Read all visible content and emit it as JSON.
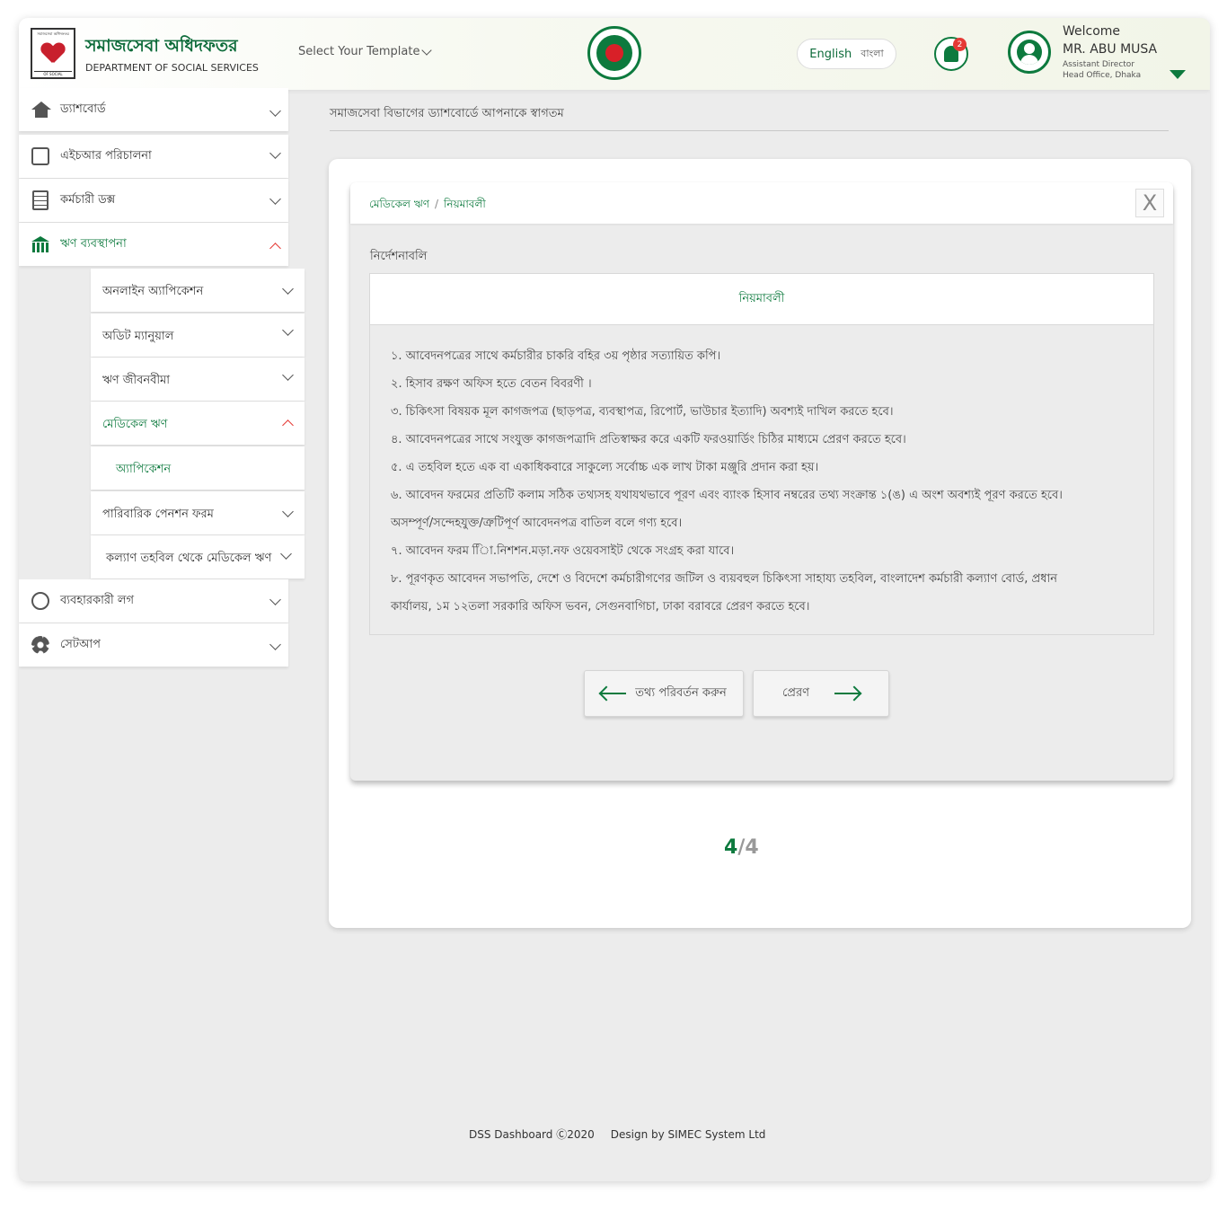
{
  "header": {
    "brand_bn": "সমাজসেবা অধিদফতর",
    "brand_en": "DEPARTMENT OF SOCIAL SERVICES",
    "logo_top": "সমাজসেবা অধিদফতর",
    "logo_bottom": "OF SOCIAL",
    "template_select": "Select Your Template",
    "lang_en": "English",
    "lang_bn": "বাংলা",
    "notification_count": "2",
    "welcome": "Welcome",
    "user_name": "MR. ABU MUSA",
    "user_role": "Assistant Director",
    "user_office": "Head Office, Dhaka"
  },
  "sidebar": {
    "items": [
      {
        "label": "ড্যাশবোর্ড",
        "icon": "home-icon"
      },
      {
        "label": "এইচআর পরিচালনা",
        "icon": "hr-icon"
      },
      {
        "label": "কর্মচারী ডক্স",
        "icon": "document-icon"
      },
      {
        "label": "ঋণ ব্যবস্থাপনা",
        "icon": "bank-icon"
      },
      {
        "label": "ব্যবহারকারী লগ",
        "icon": "user-log-icon"
      },
      {
        "label": "সেটআপ",
        "icon": "gear-icon"
      }
    ],
    "sub_items": [
      {
        "label": "অনলাইন অ্যাপিকেশন"
      },
      {
        "label": "অডিট ম্যানুয়াল"
      },
      {
        "label": "ঋণ জীবনবীমা"
      },
      {
        "label": "মেডিকেল ঋণ"
      },
      {
        "label": "অ্যাপিকেশন"
      },
      {
        "label": "পারিবারিক পেনশন ফরম"
      },
      {
        "label": "কল্যাণ তহবিল থেকে মেডিকেল ঋণ"
      }
    ]
  },
  "main": {
    "welcome_line": "সমাজসেবা বিভাগের ড্যাশবোর্ডে আপনাকে স্বাগতম",
    "breadcrumb": [
      "মেডিকেল ঋণ",
      "নিয়মাবলী"
    ],
    "breadcrumb_sep": "/",
    "close": "X",
    "instructions_label": "নির্দেশনাবলি",
    "rules_title": "নিয়মাবলী",
    "rules": [
      "১. আবেদনপত্রের সাথে কর্মচারীর চাকরি বহির ৩য় পৃষ্ঠার সত্যায়িত কপি।",
      "২. হিসাব রক্ষণ অফিস হতে বেতন বিবরণী ।",
      "৩. চিকিৎসা বিষয়ক মূল কাগজপত্র (ছাড়পত্র, ব্যবস্থাপত্র, রিপোর্ট, ভাউচার ইত্যাদি) অবশ্যই দাখিল করতে হবে।",
      "৪. আবেদনপত্রের সাথে সংযুক্ত কাগজপত্রাদি প্রতিস্বাক্ষর করে একটি ফরওয়ার্ডিং চিঠির মাধ্যমে প্রেরণ করতে হবে।",
      "৫. এ তহবিল হতে এক বা একাধিকবারে সাকুল্যে সর্বোচ্চ এক লাখ টাকা মঞ্জুরি প্রদান করা হয়।",
      "৬. আবেদন ফরমের প্রতিটি কলাম সঠিক তথ্যসহ যথাযথভাবে পূরণ এবং ব্যাংক হিসাব নম্বরের তথ্য সংক্রান্ত ১(ঙ) এ অংশ অবশ্যই পূরণ করতে হবে।",
      "অসম্পূর্ণ/সন্দেহযুক্ত/ত্রুটিপূর্ণ আবেদনপত্র বাতিল বলে গণ্য হবে।",
      "৭. আবেদন ফরম ািি.নিশশন.মড়া.নফ ওয়েবসাইট থেকে সংগ্রহ করা যাবে।",
      "৮. পূরণকৃত আবেদন সভাপতি, দেশে ও বিদেশে কর্মচারীগণের জটিল ও ব্যয়বহুল চিকিৎসা সাহায্য তহবিল, বাংলাদেশ  কর্মচারী কল্যাণ বোর্ড, প্রধান",
      "কার্যালয়, ১ম ১২তলা সরকারি অফিস ভবন, সেগুনবাগিচা, ঢাকা বরাবরে প্রেরণ করতে হবে।"
    ],
    "back_button": "তথ্য পরিবর্তন করুন",
    "send_button": "প্রেরণ",
    "pager_current": "4",
    "pager_sep": "/",
    "pager_total": "4"
  },
  "footer": {
    "copyright": "DSS Dashboard Ⓒ2020",
    "design": "Design by SIMEC System Ltd"
  },
  "colors": {
    "brand_green": "#0d7a3e",
    "alert_red": "#e53935",
    "background": "#ececec"
  }
}
